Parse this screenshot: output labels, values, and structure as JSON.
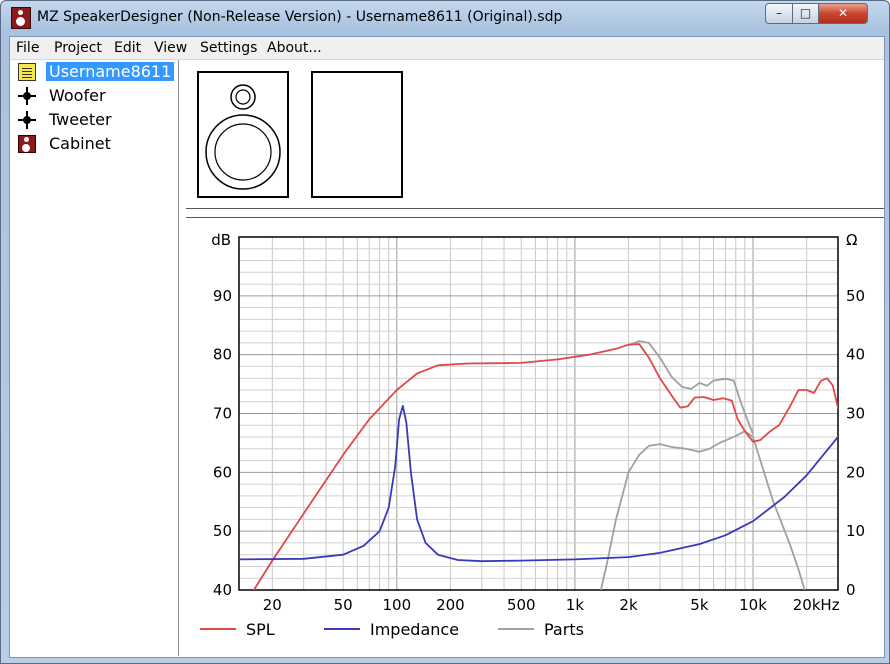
{
  "window": {
    "title": "MZ SpeakerDesigner (Non-Release Version) - Username8611 (Original).sdp",
    "minimize_glyph": "–",
    "maximize_glyph": "□",
    "close_glyph": "✕"
  },
  "menu": [
    "File",
    "Project",
    "Edit",
    "View",
    "Settings",
    "About..."
  ],
  "tree": {
    "items": [
      {
        "label": "Username8611",
        "icon": "project-icon",
        "selected": true
      },
      {
        "label": "Woofer",
        "icon": "driver-icon",
        "selected": false
      },
      {
        "label": "Tweeter",
        "icon": "driver-icon",
        "selected": false
      },
      {
        "label": "Cabinet",
        "icon": "cabinet-icon",
        "selected": false
      }
    ]
  },
  "chart_data": {
    "type": "line",
    "x_scale": "log",
    "xlim": [
      13,
      30000
    ],
    "x_tick_labels": [
      "20",
      "50",
      "100",
      "200",
      "500",
      "1k",
      "2k",
      "5k",
      "10k",
      "20k",
      "Hz"
    ],
    "x_tick_values": [
      20,
      50,
      100,
      200,
      500,
      1000,
      2000,
      5000,
      10000,
      20000
    ],
    "ylabel_left": "dB",
    "ylim_left": [
      40,
      100
    ],
    "y_left_ticks": [
      "40",
      "50",
      "60",
      "70",
      "80",
      "90"
    ],
    "ylabel_right": "Ω",
    "ylim_right": [
      0,
      60
    ],
    "y_right_ticks": [
      "0",
      "10",
      "20",
      "30",
      "40",
      "50"
    ],
    "grid": true,
    "legend_position": "bottom",
    "series": [
      {
        "name": "SPL",
        "color": "#e04848",
        "axis": "left",
        "points": [
          [
            15,
            39
          ],
          [
            20,
            45
          ],
          [
            30,
            53
          ],
          [
            50,
            63
          ],
          [
            70,
            69
          ],
          [
            100,
            74
          ],
          [
            130,
            76.8
          ],
          [
            170,
            78.2
          ],
          [
            250,
            78.5
          ],
          [
            500,
            78.6
          ],
          [
            800,
            79.2
          ],
          [
            1200,
            80
          ],
          [
            1700,
            81
          ],
          [
            2000,
            81.7
          ],
          [
            2300,
            81.8
          ],
          [
            2600,
            79.5
          ],
          [
            3000,
            76
          ],
          [
            3500,
            73
          ],
          [
            3900,
            71
          ],
          [
            4300,
            71.2
          ],
          [
            4700,
            72.7
          ],
          [
            5300,
            72.8
          ],
          [
            6000,
            72.3
          ],
          [
            6800,
            72.6
          ],
          [
            7600,
            72.2
          ],
          [
            8200,
            69
          ],
          [
            9000,
            67
          ],
          [
            10000,
            65.2
          ],
          [
            11000,
            65.5
          ],
          [
            12500,
            67
          ],
          [
            14000,
            68
          ],
          [
            16000,
            71
          ],
          [
            18000,
            74
          ],
          [
            20000,
            74
          ],
          [
            22000,
            73.5
          ],
          [
            24000,
            75.5
          ],
          [
            26000,
            76
          ],
          [
            28000,
            74.8
          ],
          [
            30000,
            71
          ],
          [
            35000,
            68
          ],
          [
            38000,
            66.5
          ]
        ]
      },
      {
        "name": "Impedance",
        "color": "#3a3ab8",
        "axis": "right",
        "points": [
          [
            13,
            5.2
          ],
          [
            30,
            5.3
          ],
          [
            50,
            6
          ],
          [
            65,
            7.5
          ],
          [
            80,
            10
          ],
          [
            90,
            14
          ],
          [
            98,
            21
          ],
          [
            103,
            29
          ],
          [
            108,
            31.3
          ],
          [
            113,
            28.5
          ],
          [
            120,
            20
          ],
          [
            130,
            12
          ],
          [
            145,
            8
          ],
          [
            170,
            6
          ],
          [
            220,
            5.1
          ],
          [
            300,
            4.9
          ],
          [
            500,
            5
          ],
          [
            1000,
            5.2
          ],
          [
            2000,
            5.6
          ],
          [
            3000,
            6.3
          ],
          [
            5000,
            7.8
          ],
          [
            7000,
            9.3
          ],
          [
            10000,
            11.7
          ],
          [
            15000,
            15.8
          ],
          [
            20000,
            19.5
          ],
          [
            30000,
            26
          ],
          [
            40000,
            31
          ]
        ]
      },
      {
        "name": "Parts",
        "color": "#a0a0a0",
        "axis": "right",
        "points": [
          [
            1400,
            0
          ],
          [
            1500,
            4
          ],
          [
            1700,
            12
          ],
          [
            2000,
            20
          ],
          [
            2300,
            23
          ],
          [
            2600,
            24.5
          ],
          [
            3000,
            24.8
          ],
          [
            3500,
            24.3
          ],
          [
            4200,
            24
          ],
          [
            5000,
            23.5
          ],
          [
            5700,
            24
          ],
          [
            6500,
            25
          ],
          [
            8000,
            26.2
          ],
          [
            9000,
            27
          ],
          [
            10000,
            26
          ],
          [
            11000,
            22
          ],
          [
            13000,
            15
          ],
          [
            16000,
            8
          ],
          [
            18000,
            3.5
          ],
          [
            19500,
            0
          ]
        ]
      },
      {
        "name": "Parts",
        "color": "#a0a0a0",
        "axis": "left",
        "legend": false,
        "points": [
          [
            2000,
            81.6
          ],
          [
            2300,
            82.3
          ],
          [
            2600,
            82
          ],
          [
            3000,
            79.5
          ],
          [
            3500,
            76.2
          ],
          [
            4000,
            74.5
          ],
          [
            4500,
            74.2
          ],
          [
            5000,
            75.2
          ],
          [
            5500,
            74.7
          ],
          [
            6000,
            75.6
          ],
          [
            7000,
            75.9
          ],
          [
            7800,
            75.6
          ],
          [
            8300,
            73
          ],
          [
            9000,
            70
          ],
          [
            10000,
            66.5
          ]
        ]
      }
    ]
  }
}
